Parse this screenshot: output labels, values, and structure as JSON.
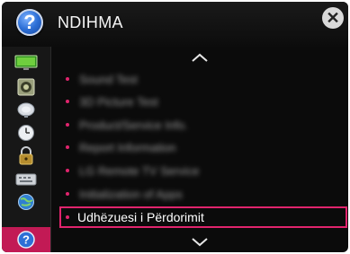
{
  "header": {
    "title": "NDIHMA",
    "help_badge": "?",
    "close_glyph": "✕"
  },
  "sidebar": {
    "items": [
      {
        "icon": "screen-icon"
      },
      {
        "icon": "speaker-icon"
      },
      {
        "icon": "satellite-dish-icon"
      },
      {
        "icon": "clock-icon"
      },
      {
        "icon": "lock-icon"
      },
      {
        "icon": "keyboard-icon"
      },
      {
        "icon": "globe-icon"
      },
      {
        "icon": "help-icon",
        "active": true
      }
    ],
    "active_glyph": "?"
  },
  "menu": {
    "items": [
      {
        "label": "Sound Test",
        "blurred": true
      },
      {
        "label": "3D Picture Test",
        "blurred": true
      },
      {
        "label": "Product/Service Info.",
        "blurred": true
      },
      {
        "label": "Report Information",
        "blurred": true
      },
      {
        "label": "LG Remote TV Service",
        "blurred": true
      },
      {
        "label": "Initialization of Apps",
        "blurred": true
      },
      {
        "label": "Udhëzuesi i Përdorimit",
        "selected": true
      }
    ]
  },
  "colors": {
    "accent": "#e0246d",
    "background": "#0b0b0b",
    "sidebar": "#171717"
  }
}
